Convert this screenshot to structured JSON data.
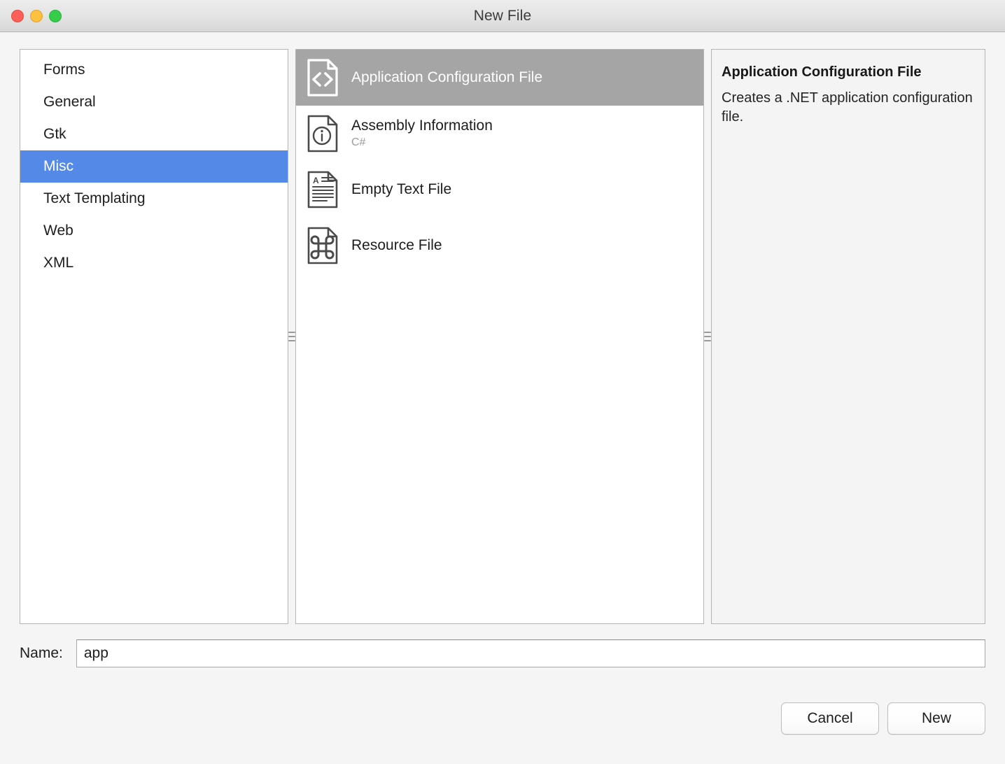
{
  "window": {
    "title": "New File",
    "traffic_lights": [
      {
        "name": "close",
        "color": "#fc6058"
      },
      {
        "name": "minimize",
        "color": "#fec041"
      },
      {
        "name": "zoom",
        "color": "#35cd4b"
      }
    ]
  },
  "colors": {
    "selection_blue": "#5489e8",
    "selection_gray": "#a5a5a6",
    "window_background": "#f5f5f5",
    "pane_border": "#b5b5b5"
  },
  "categories": {
    "items": [
      {
        "label": "Forms",
        "selected": false
      },
      {
        "label": "General",
        "selected": false
      },
      {
        "label": "Gtk",
        "selected": false
      },
      {
        "label": "Misc",
        "selected": true
      },
      {
        "label": "Text Templating",
        "selected": false
      },
      {
        "label": "Web",
        "selected": false
      },
      {
        "label": "XML",
        "selected": false
      }
    ]
  },
  "templates": {
    "items": [
      {
        "title": "Application Configuration File",
        "subtitle": "",
        "icon": "code-file-icon",
        "selected": true
      },
      {
        "title": "Assembly Information",
        "subtitle": "C#",
        "icon": "info-file-icon",
        "selected": false
      },
      {
        "title": "Empty Text File",
        "subtitle": "",
        "icon": "text-file-icon",
        "selected": false
      },
      {
        "title": "Resource File",
        "subtitle": "",
        "icon": "command-file-icon",
        "selected": false
      }
    ]
  },
  "details": {
    "title": "Application Configuration File",
    "description": "Creates a .NET application configuration file."
  },
  "name_field": {
    "label": "Name:",
    "value": "app",
    "placeholder": ""
  },
  "footer": {
    "cancel_label": "Cancel",
    "new_label": "New"
  }
}
